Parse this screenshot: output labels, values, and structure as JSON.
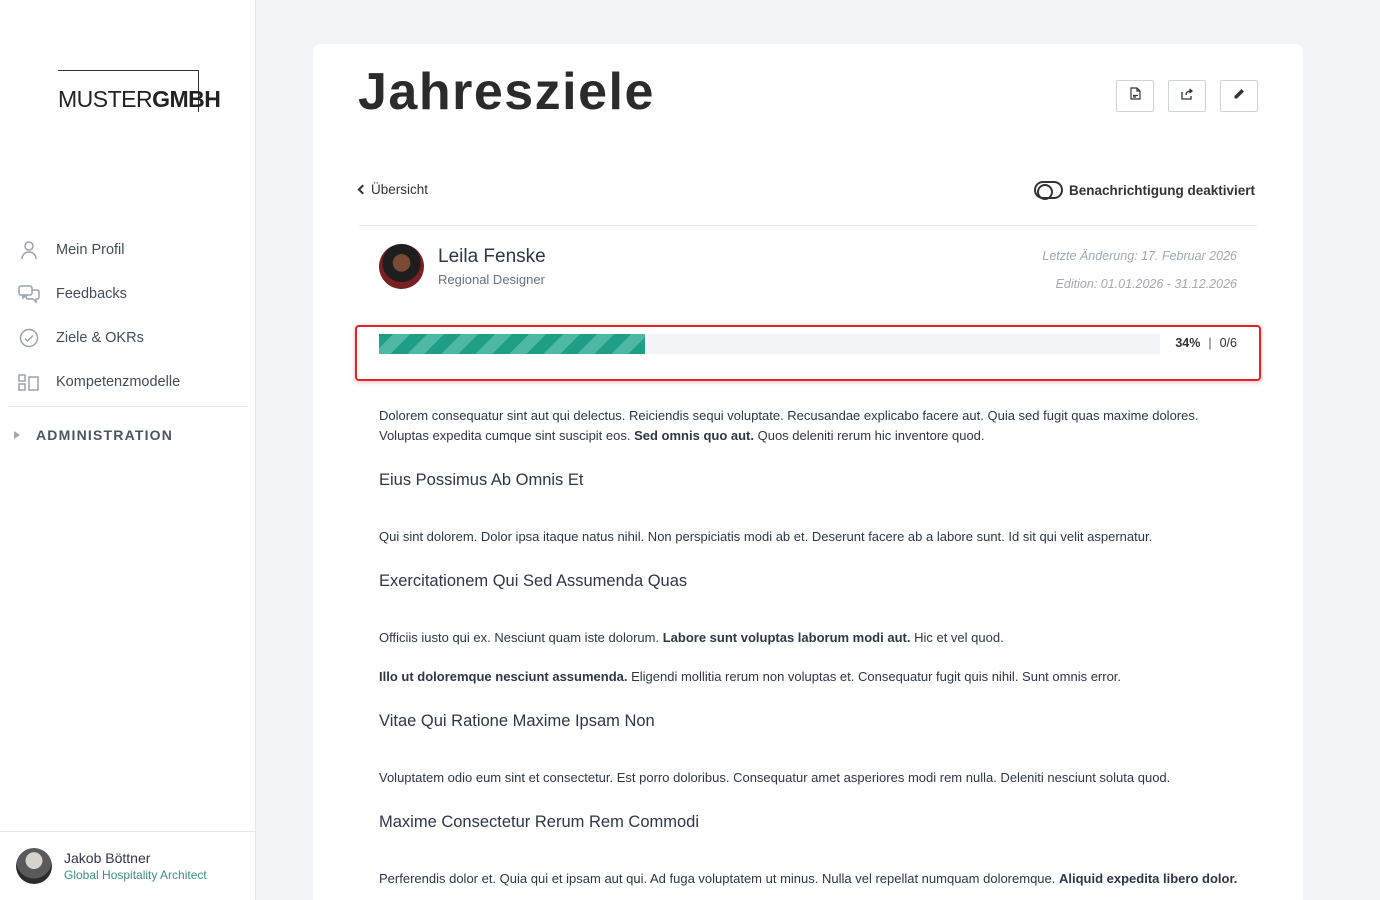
{
  "sidebar": {
    "logo": {
      "part1": "MUSTER",
      "part2": "GMBH"
    },
    "nav": [
      {
        "label": "Mein Profil",
        "icon": "user-icon"
      },
      {
        "label": "Feedbacks",
        "icon": "chat-icon"
      },
      {
        "label": "Ziele & OKRs",
        "icon": "check-circle-icon"
      },
      {
        "label": "Kompetenzmodelle",
        "icon": "competency-icon"
      }
    ],
    "admin_label": "ADMINISTRATION",
    "user": {
      "name": "Jakob Böttner",
      "role": "Global Hospitality Architect"
    }
  },
  "page": {
    "title": "Jahresziele",
    "back_label": "Übersicht",
    "notification_label": "Benachrichtigung deaktiviert",
    "toolbar": [
      {
        "icon": "pdf-icon"
      },
      {
        "icon": "share-icon"
      },
      {
        "icon": "pencil-icon"
      }
    ]
  },
  "person": {
    "name": "Leila Fenske",
    "role": "Regional Designer",
    "last_change": "Letzte Änderung: 17. Februar 2026",
    "edition": "Edition: 01.01.2026 - 31.12.2026"
  },
  "progress": {
    "percent": 34,
    "percent_label": "34%",
    "count_label": "0/6"
  },
  "content": {
    "intro_a": "Dolorem consequatur sint aut qui delectus. Reiciendis sequi voluptate. Recusandae explicabo facere aut. Quia sed fugit quas maxime dolores. Voluptas expedita cumque sint suscipit eos. ",
    "intro_bold": "Sed omnis quo aut.",
    "intro_b": " Quos deleniti rerum hic inventore quod.",
    "h1": "Eius Possimus Ab Omnis Et",
    "p1": "Qui sint dolorem. Dolor ipsa itaque natus nihil. Non perspiciatis modi ab et. Deserunt facere ab a labore sunt. Id sit qui velit aspernatur.",
    "h2": "Exercitationem Qui Sed Assumenda Quas",
    "p2a": "Officiis iusto qui ex. Nesciunt quam iste dolorum. ",
    "p2bold": "Labore sunt voluptas laborum modi aut.",
    "p2b": " Hic et vel quod.",
    "p3bold": "Illo ut doloremque nesciunt assumenda.",
    "p3": " Eligendi mollitia rerum non voluptas et. Consequatur fugit quis nihil. Sunt omnis error.",
    "h3": "Vitae Qui Ratione Maxime Ipsam Non",
    "p4": "Voluptatem odio eum sint et consectetur. Est porro doloribus. Consequatur amet asperiores modi rem nulla. Deleniti nesciunt soluta quod.",
    "h4": "Maxime Consectetur Rerum Rem Commodi",
    "p5a": "Perferendis dolor et. Quia qui et ipsam aut qui. Ad fuga voluptatem ut minus. Nulla vel repellat numquam doloremque. ",
    "p5bold": "Aliquid expedita libero dolor."
  },
  "colors": {
    "accent": "#1f9e86",
    "highlight": "#e0252a"
  }
}
